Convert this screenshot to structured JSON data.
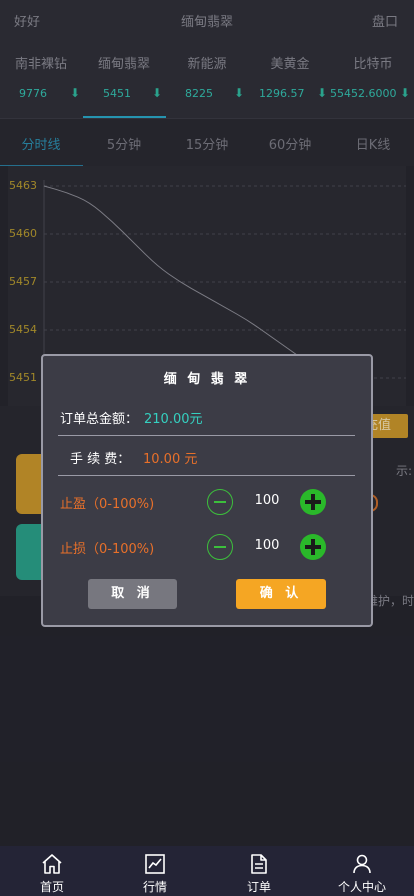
{
  "header": {
    "left": "好好",
    "title": "缅甸翡翠",
    "right": "盘口"
  },
  "tickers": [
    {
      "name": "南非裸钻",
      "value": "9776"
    },
    {
      "name": "缅甸翡翠",
      "value": "5451"
    },
    {
      "name": "新能源",
      "value": "8225"
    },
    {
      "name": "美黄金",
      "value": "1296.57"
    },
    {
      "name": "比特币",
      "value": "55452.6000"
    }
  ],
  "periods": [
    "分时线",
    "5分钟",
    "15分钟",
    "60分钟",
    "日K线"
  ],
  "chart_data": {
    "type": "line",
    "y_ticks": [
      "5463",
      "5460",
      "5457",
      "5454",
      "5451"
    ],
    "ylim": [
      5451,
      5463
    ],
    "series": [
      {
        "values": [
          5463.0,
          5462.6,
          5462.0,
          5460.8,
          5459.4,
          5458.0,
          5457.0,
          5456.2,
          5455.4,
          5454.6,
          5453.6,
          5452.6,
          5451.6
        ]
      }
    ],
    "grid": true
  },
  "lower": {
    "recharge": "充值",
    "right_snippet": "示:",
    "right_snippet_2": "维护，时"
  },
  "modal": {
    "title": "缅 甸 翡 翠",
    "total_label": "订单总金额：",
    "total_value": "210.00元",
    "fee_label": "手 续 费：",
    "fee_value": "10.00 元",
    "take_profit_label": "止盈（0-100%)",
    "take_profit_value": "100",
    "stop_loss_label": "止损（0-100%)",
    "stop_loss_value": "100",
    "cancel": "取 消",
    "confirm": "确 认"
  },
  "nav": [
    {
      "label": "首页",
      "icon": "home-icon"
    },
    {
      "label": "行情",
      "icon": "chart-icon"
    },
    {
      "label": "订单",
      "icon": "document-icon"
    },
    {
      "label": "个人中心",
      "icon": "user-icon"
    }
  ],
  "colors": {
    "accent_teal": "#34c0b0",
    "accent_orange": "#e8702a",
    "confirm": "#f5a623",
    "positive_green": "#2ab82a"
  }
}
